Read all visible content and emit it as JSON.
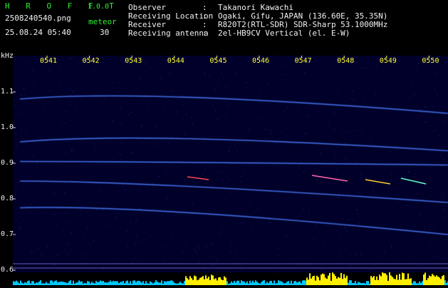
{
  "header": {
    "brand": "H R O F F T",
    "version": "1.0.0",
    "filename": "2508240540.png",
    "meteor_label": "meteor",
    "datetime": "25.08.24 05:40",
    "meteor_count": "30"
  },
  "info": [
    {
      "label": "Observer",
      "sep": ":",
      "value": "Takanori Kawachi"
    },
    {
      "label": "Receiving Location",
      "sep": ":",
      "value": "Ogaki, Gifu, JAPAN (136.60E, 35.35N)"
    },
    {
      "label": "Receiver",
      "sep": ":",
      "value": "R820T2(RTL-SDR) SDR-Sharp 53.1000MHz"
    },
    {
      "label": "Receiving antenna",
      "sep": ":",
      "value": "2el-HB9CV Vertical (el. E-W)"
    }
  ],
  "axis": {
    "unit": "kHz",
    "time_ticks": [
      "0541",
      "0542",
      "0543",
      "0544",
      "0545",
      "0546",
      "0547",
      "0548",
      "0549",
      "0550"
    ],
    "freq_ticks": [
      "1.1",
      "1.0",
      "0.9",
      "0.8",
      "0.7",
      "0.6"
    ]
  },
  "chart_data": {
    "type": "heatmap",
    "xlabel": "",
    "ylabel": "kHz",
    "x": [
      "0541",
      "0542",
      "0543",
      "0544",
      "0545",
      "0546",
      "0547",
      "0548",
      "0549",
      "0550"
    ],
    "ylim": [
      0.6,
      1.1
    ],
    "traces": [
      {
        "freq_start": 1.08,
        "freq_peak": 1.095,
        "freq_end": 1.04
      },
      {
        "freq_start": 0.96,
        "freq_peak": 0.975,
        "freq_end": 0.935
      },
      {
        "freq_start": 0.905,
        "freq_peak": 0.905,
        "freq_end": 0.895
      },
      {
        "freq_start": 0.85,
        "freq_peak": 0.85,
        "freq_end": 0.79
      },
      {
        "freq_start": 0.775,
        "freq_peak": 0.78,
        "freq_end": 0.7
      },
      {
        "freq_start": 0.625,
        "freq_peak": 0.625,
        "freq_end": 0.625
      }
    ],
    "colors": {
      "background": "#01002a",
      "trace": "#4a7dff",
      "header_text": "#33ee33",
      "info_text": "#f2f2f2",
      "ticks": "#ffff33",
      "strip_low": "#00c8ff",
      "strip_high": "#ffee00"
    }
  }
}
